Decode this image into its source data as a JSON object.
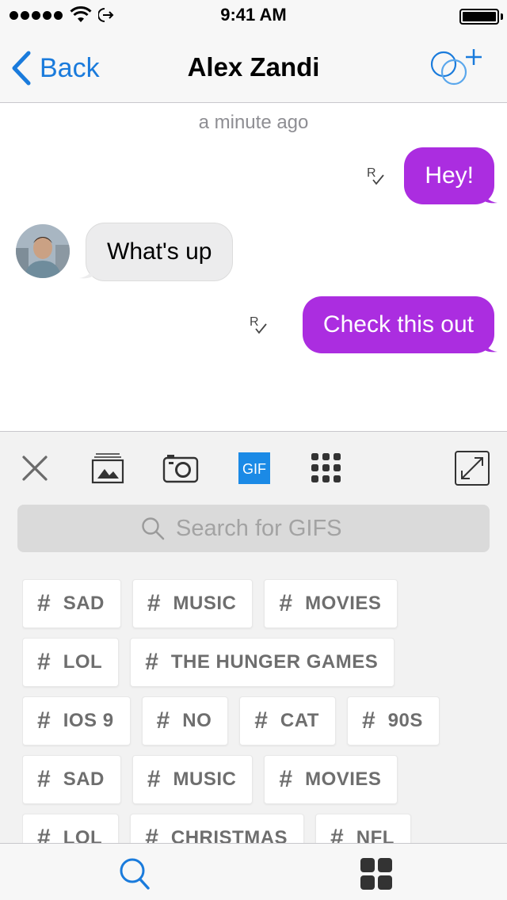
{
  "status_bar": {
    "time": "9:41 AM",
    "signal_dots": 5,
    "battery_level": 1.0
  },
  "nav": {
    "back_label": "Back",
    "title": "Alex Zandi",
    "accent_color": "#1a7bdc"
  },
  "chat": {
    "timestamp": "a minute ago",
    "messages": [
      {
        "direction": "outgoing",
        "text": "Hey!",
        "receipt": "read"
      },
      {
        "direction": "incoming",
        "text": "What's up"
      },
      {
        "direction": "outgoing",
        "text": "Check this out",
        "receipt": "read"
      }
    ],
    "outgoing_color": "#ab2de0",
    "incoming_color": "#ececed"
  },
  "toolbar": {
    "items": [
      "close-icon",
      "gallery-icon",
      "camera-icon",
      "gif-icon",
      "grid-icon",
      "expand-icon"
    ],
    "gif_label": "GIF",
    "active": "gif"
  },
  "search": {
    "placeholder": "Search for GIFS",
    "value": ""
  },
  "tags": {
    "rows": [
      [
        "SAD",
        "MUSIC",
        "MOVIES"
      ],
      [
        "LOL",
        "THE HUNGER GAMES"
      ],
      [
        "IOS 9",
        "NO",
        "CAT",
        "90S"
      ],
      [
        "SAD",
        "MUSIC",
        "MOVIES"
      ],
      [
        "LOL",
        "CHRISTMAS",
        "NFL"
      ]
    ],
    "hash_symbol": "#"
  },
  "tab_bar": {
    "items": [
      "search-icon",
      "apps-grid-icon"
    ],
    "active": "search"
  }
}
